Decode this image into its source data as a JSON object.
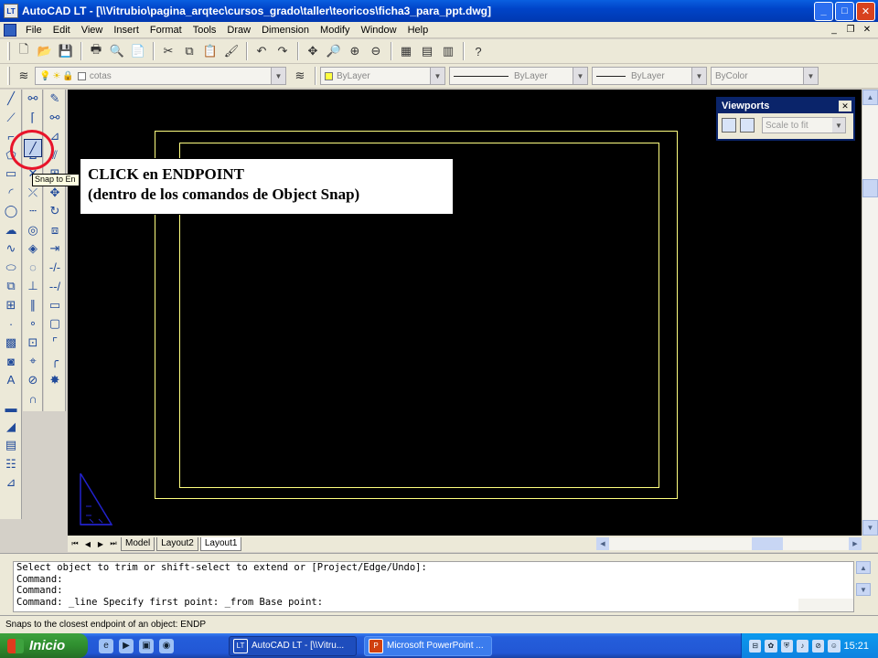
{
  "window": {
    "app_icon": "LT",
    "title": "AutoCAD LT - [\\\\Vitrubio\\pagina_arqtec\\cursos_grado\\taller\\teoricos\\ficha3_para_ppt.dwg]",
    "minimize": "_",
    "maximize": "□",
    "close": "✕"
  },
  "menubar": {
    "items": [
      "File",
      "Edit",
      "View",
      "Insert",
      "Format",
      "Tools",
      "Draw",
      "Dimension",
      "Modify",
      "Window",
      "Help"
    ],
    "doc_minimize": "_",
    "doc_restore": "❐",
    "doc_close": "✕"
  },
  "toolbar2": {
    "layer": "cotas",
    "color": "ByLayer",
    "linetype": "ByLayer",
    "lineweight": "ByLayer",
    "plotstyle": "ByColor",
    "color_swatch": "#ffff40"
  },
  "viewports": {
    "title": "Viewports",
    "scale": "Scale to fit"
  },
  "callout": {
    "line1": "CLICK en ENDPOINT",
    "line2": "(dentro de los comandos de Object Snap)"
  },
  "tooltip": "Snap to En",
  "tabs": [
    "Model",
    "Layout2",
    "Layout1"
  ],
  "active_tab": "Layout1",
  "command": {
    "lines": [
      "Select object to trim or shift-select to extend or [Project/Edge/Undo]:",
      "Command:",
      "Command:",
      "Command: _line Specify first point: _from Base point:"
    ]
  },
  "status": "Snaps to the closest endpoint of an object:  ENDP",
  "taskbar": {
    "start": "Inicio",
    "tasks": [
      {
        "icon": "LT",
        "label": "AutoCAD LT - [\\\\Vitru..."
      },
      {
        "icon": "P",
        "label": "Microsoft PowerPoint ..."
      }
    ],
    "clock": "15:21"
  },
  "colors": {
    "frame": "#ffff80",
    "highlight": "#e8142a",
    "ucs": "#2222cc"
  }
}
